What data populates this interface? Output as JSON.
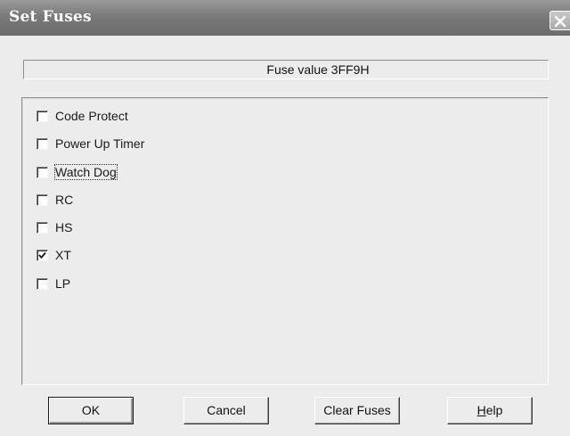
{
  "window": {
    "title": "Set Fuses"
  },
  "fuse_value_text": "Fuse value 3FF9H",
  "options": [
    {
      "label": "Code Protect",
      "checked": false
    },
    {
      "label": "Power Up Timer",
      "checked": false
    },
    {
      "label": "Watch Dog",
      "checked": false,
      "focused": true
    },
    {
      "label": "RC",
      "checked": false
    },
    {
      "label": "HS",
      "checked": false
    },
    {
      "label": "XT",
      "checked": true
    },
    {
      "label": "LP",
      "checked": false
    }
  ],
  "buttons": {
    "ok": "OK",
    "cancel": "Cancel",
    "clear_fuses": "Clear Fuses",
    "help_mnemonic": "H",
    "help_rest": "elp"
  },
  "icons": {
    "close": "close-icon",
    "check": "checkmark-icon"
  },
  "colors": {
    "titlebar": "#7a7a7a",
    "dialog_bg": "#ececec",
    "title_text": "#ffffff"
  }
}
